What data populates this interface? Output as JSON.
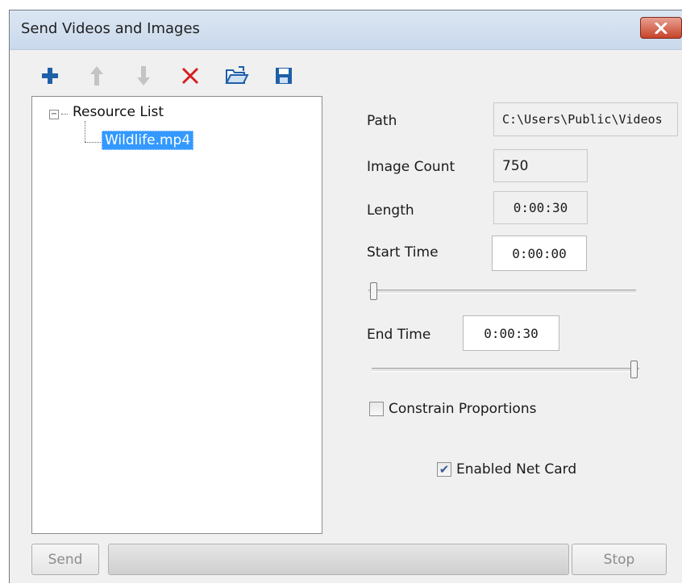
{
  "window": {
    "title": "Send Videos and Images"
  },
  "toolbar": {
    "buttons": [
      {
        "name": "add",
        "icon": "plus-icon"
      },
      {
        "name": "move-up",
        "icon": "arrow-up-icon"
      },
      {
        "name": "move-down",
        "icon": "arrow-down-icon"
      },
      {
        "name": "delete",
        "icon": "red-x-icon"
      },
      {
        "name": "open",
        "icon": "open-folder-icon"
      },
      {
        "name": "save",
        "icon": "floppy-disk-icon"
      }
    ]
  },
  "tree": {
    "root_label": "Resource List",
    "expander": "−",
    "items": [
      {
        "label": "Wildlife.mp4",
        "selected": true
      }
    ]
  },
  "fields": {
    "path_label": "Path",
    "path_value": "C:\\Users\\Public\\Videos",
    "image_count_label": "Image Count",
    "image_count_value": "750",
    "length_label": "Length",
    "length_value": "0:00:30",
    "start_time_label": "Start Time",
    "start_time_value": "0:00:00",
    "end_time_label": "End Time",
    "end_time_value": "0:00:30"
  },
  "sliders": {
    "start_position": 0.0,
    "end_position": 1.0
  },
  "options": {
    "constrain_label": "Constrain Proportions",
    "constrain_checked": false,
    "netcard_label": "Enabled Net Card",
    "netcard_checked": true,
    "check_glyph": "✔"
  },
  "footer": {
    "send_label": "Send",
    "stop_label": "Stop",
    "progress": 0.0
  },
  "colors": {
    "selection": "#3399ff",
    "icon_blue": "#1f5fa8",
    "icon_red": "#d42020",
    "close_red": "#c7432a"
  }
}
